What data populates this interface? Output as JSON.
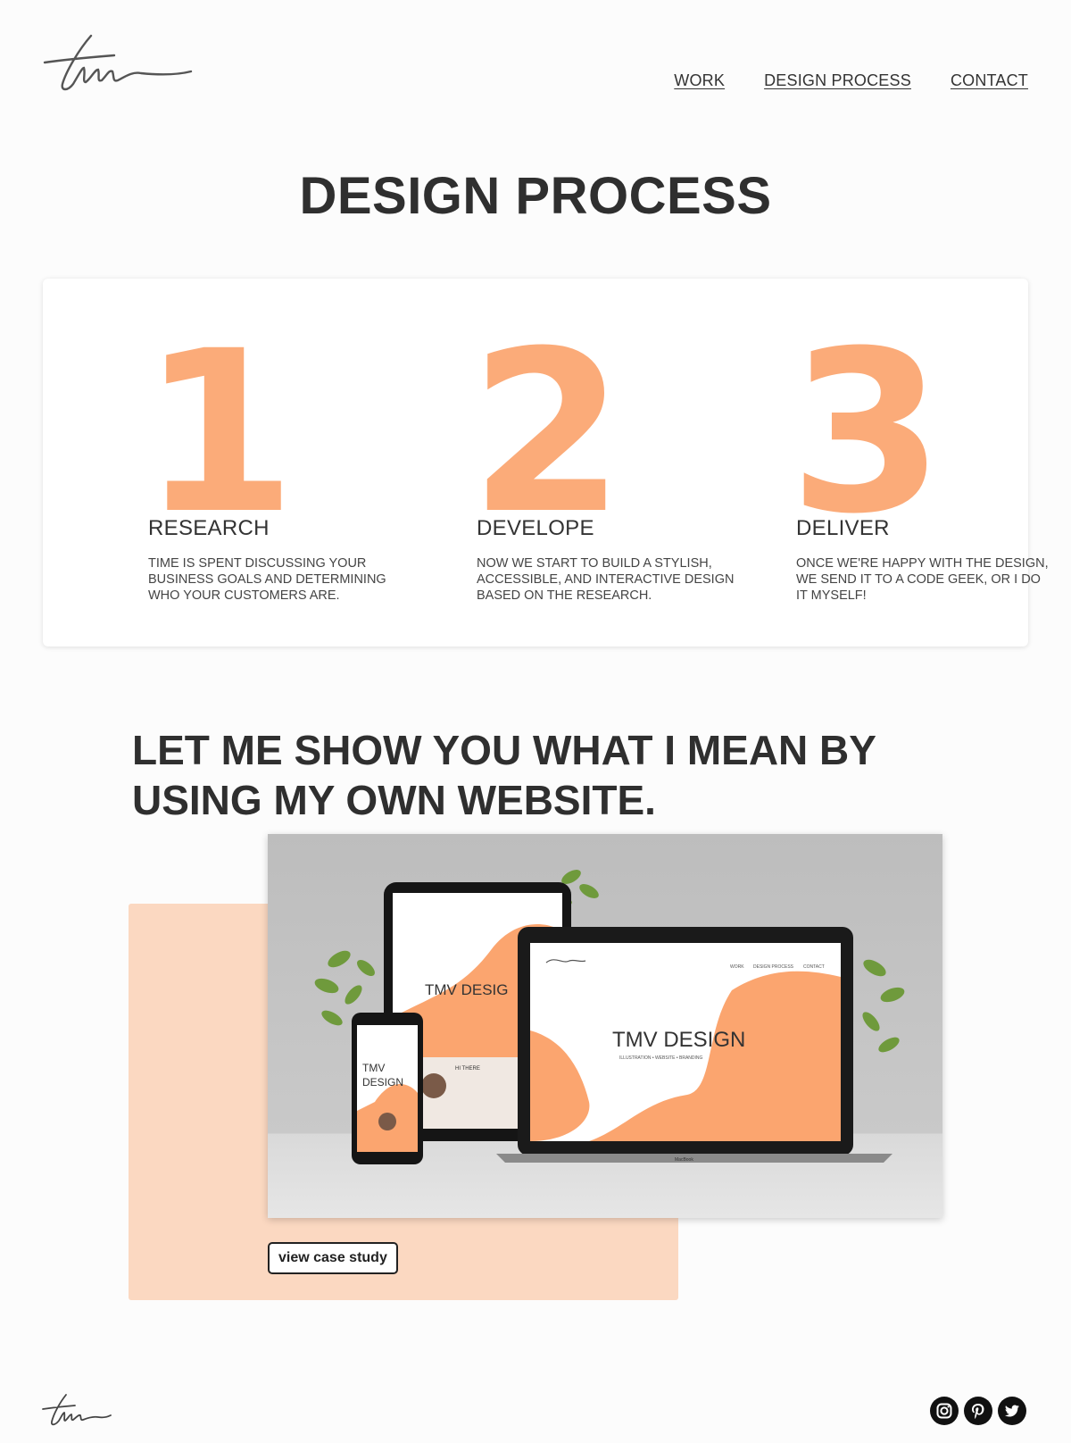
{
  "nav": {
    "items": [
      "WORK",
      "DESIGN PROCESS",
      "CONTACT"
    ]
  },
  "page": {
    "title": "DESIGN PROCESS"
  },
  "steps": [
    {
      "number": "1",
      "title": "RESEARCH",
      "text": "TIME IS SPENT DISCUSSING YOUR BUSINESS GOALS AND DETERMINING WHO YOUR CUSTOMERS ARE."
    },
    {
      "number": "2",
      "title": "DEVELOPE",
      "text": "NOW WE START TO BUILD A STYLISH, ACCESSIBLE, AND INTERACTIVE DESIGN BASED ON THE RESEARCH."
    },
    {
      "number": "3",
      "title": "DELIVER",
      "text": "ONCE WE'RE HAPPY WITH THE DESIGN, WE SEND IT TO A CODE GEEK, OR I DO IT MYSELF!"
    }
  ],
  "showcase": {
    "heading": "LET ME SHOW YOU WHAT I MEAN BY USING MY OWN WEBSITE.",
    "button_label": "view case study",
    "mockup": {
      "laptop_title": "TMV DESIGN",
      "laptop_subtitle": "ILLUSTRATION • WEBSITE • BRANDING",
      "laptop_nav": [
        "WORK",
        "DESIGN PROCESS",
        "CONTACT"
      ],
      "tablet_title": "TMV DESIG",
      "phone_title_line1": "TMV",
      "phone_title_line2": "DESIGN",
      "tablet_greeting": "HI THERE",
      "laptop_brand": "MacBook"
    }
  },
  "footer": {
    "social": [
      "instagram-icon",
      "pinterest-icon",
      "twitter-icon"
    ]
  },
  "colors": {
    "accent": "#fbab79",
    "accent_light": "#fbd8c1",
    "text": "#333333",
    "background": "#fcfcfc"
  }
}
